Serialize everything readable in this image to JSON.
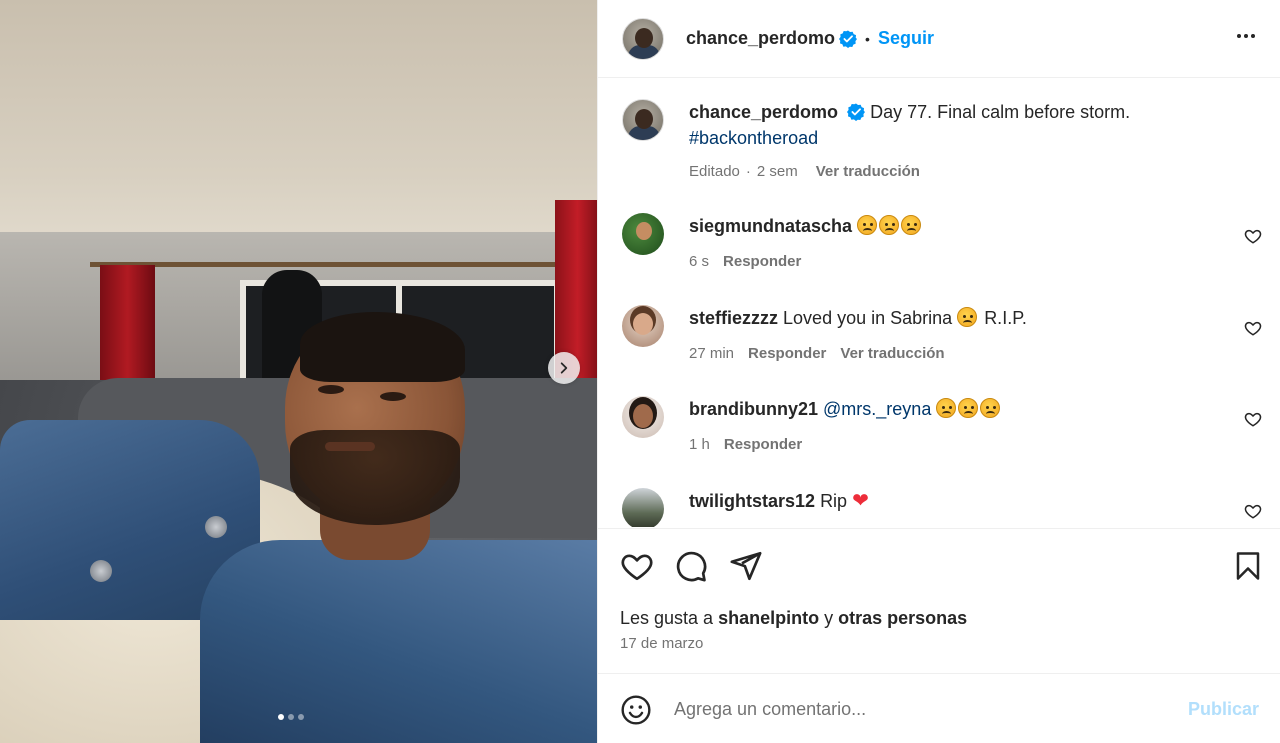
{
  "post": {
    "username": "chance_perdomo",
    "follow_label": "Seguir",
    "dot_separator": "•",
    "more_label": "•••",
    "caption": "Day 77. Final calm before storm.",
    "hashtag": "#backontheroad",
    "edited_label": "Editado",
    "time_sep": "·",
    "age": "2 sem",
    "translate_label": "Ver traducción",
    "media_dots_count": 3,
    "media_active_dot": 1
  },
  "comments": [
    {
      "username": "siegmundnatascha",
      "text": "",
      "emoji": [
        "😦",
        "😦",
        "😦"
      ],
      "time": "6 s",
      "reply": "Responder",
      "translate": ""
    },
    {
      "username": "steffiezzzz",
      "text": "Loved you in Sabrina",
      "emoji_mid": "😦",
      "text2": "R.I.P.",
      "time": "27 min",
      "reply": "Responder",
      "translate": "Ver traducción"
    },
    {
      "username": "brandibunny21",
      "mention": "@mrs._reyna",
      "emoji": [
        "🙁",
        "🙁",
        "🙁"
      ],
      "time": "1 h",
      "reply": "Responder",
      "translate": ""
    },
    {
      "username": "twilightstars12",
      "text": "Rip",
      "heart": "❤"
    }
  ],
  "likes": {
    "prefix": "Les gusta a",
    "user": "shanelpinto",
    "joiner": "y",
    "others": "otras personas"
  },
  "date": "17 de marzo",
  "composer": {
    "placeholder": "Agrega un comentario...",
    "publish": "Publicar"
  },
  "colors": {
    "accent": "#0095f6",
    "publish_disabled": "#b2dffc",
    "link": "#00376b",
    "muted": "#737373",
    "verified": "#0095f6",
    "like_heart": "#ed2d3a"
  }
}
